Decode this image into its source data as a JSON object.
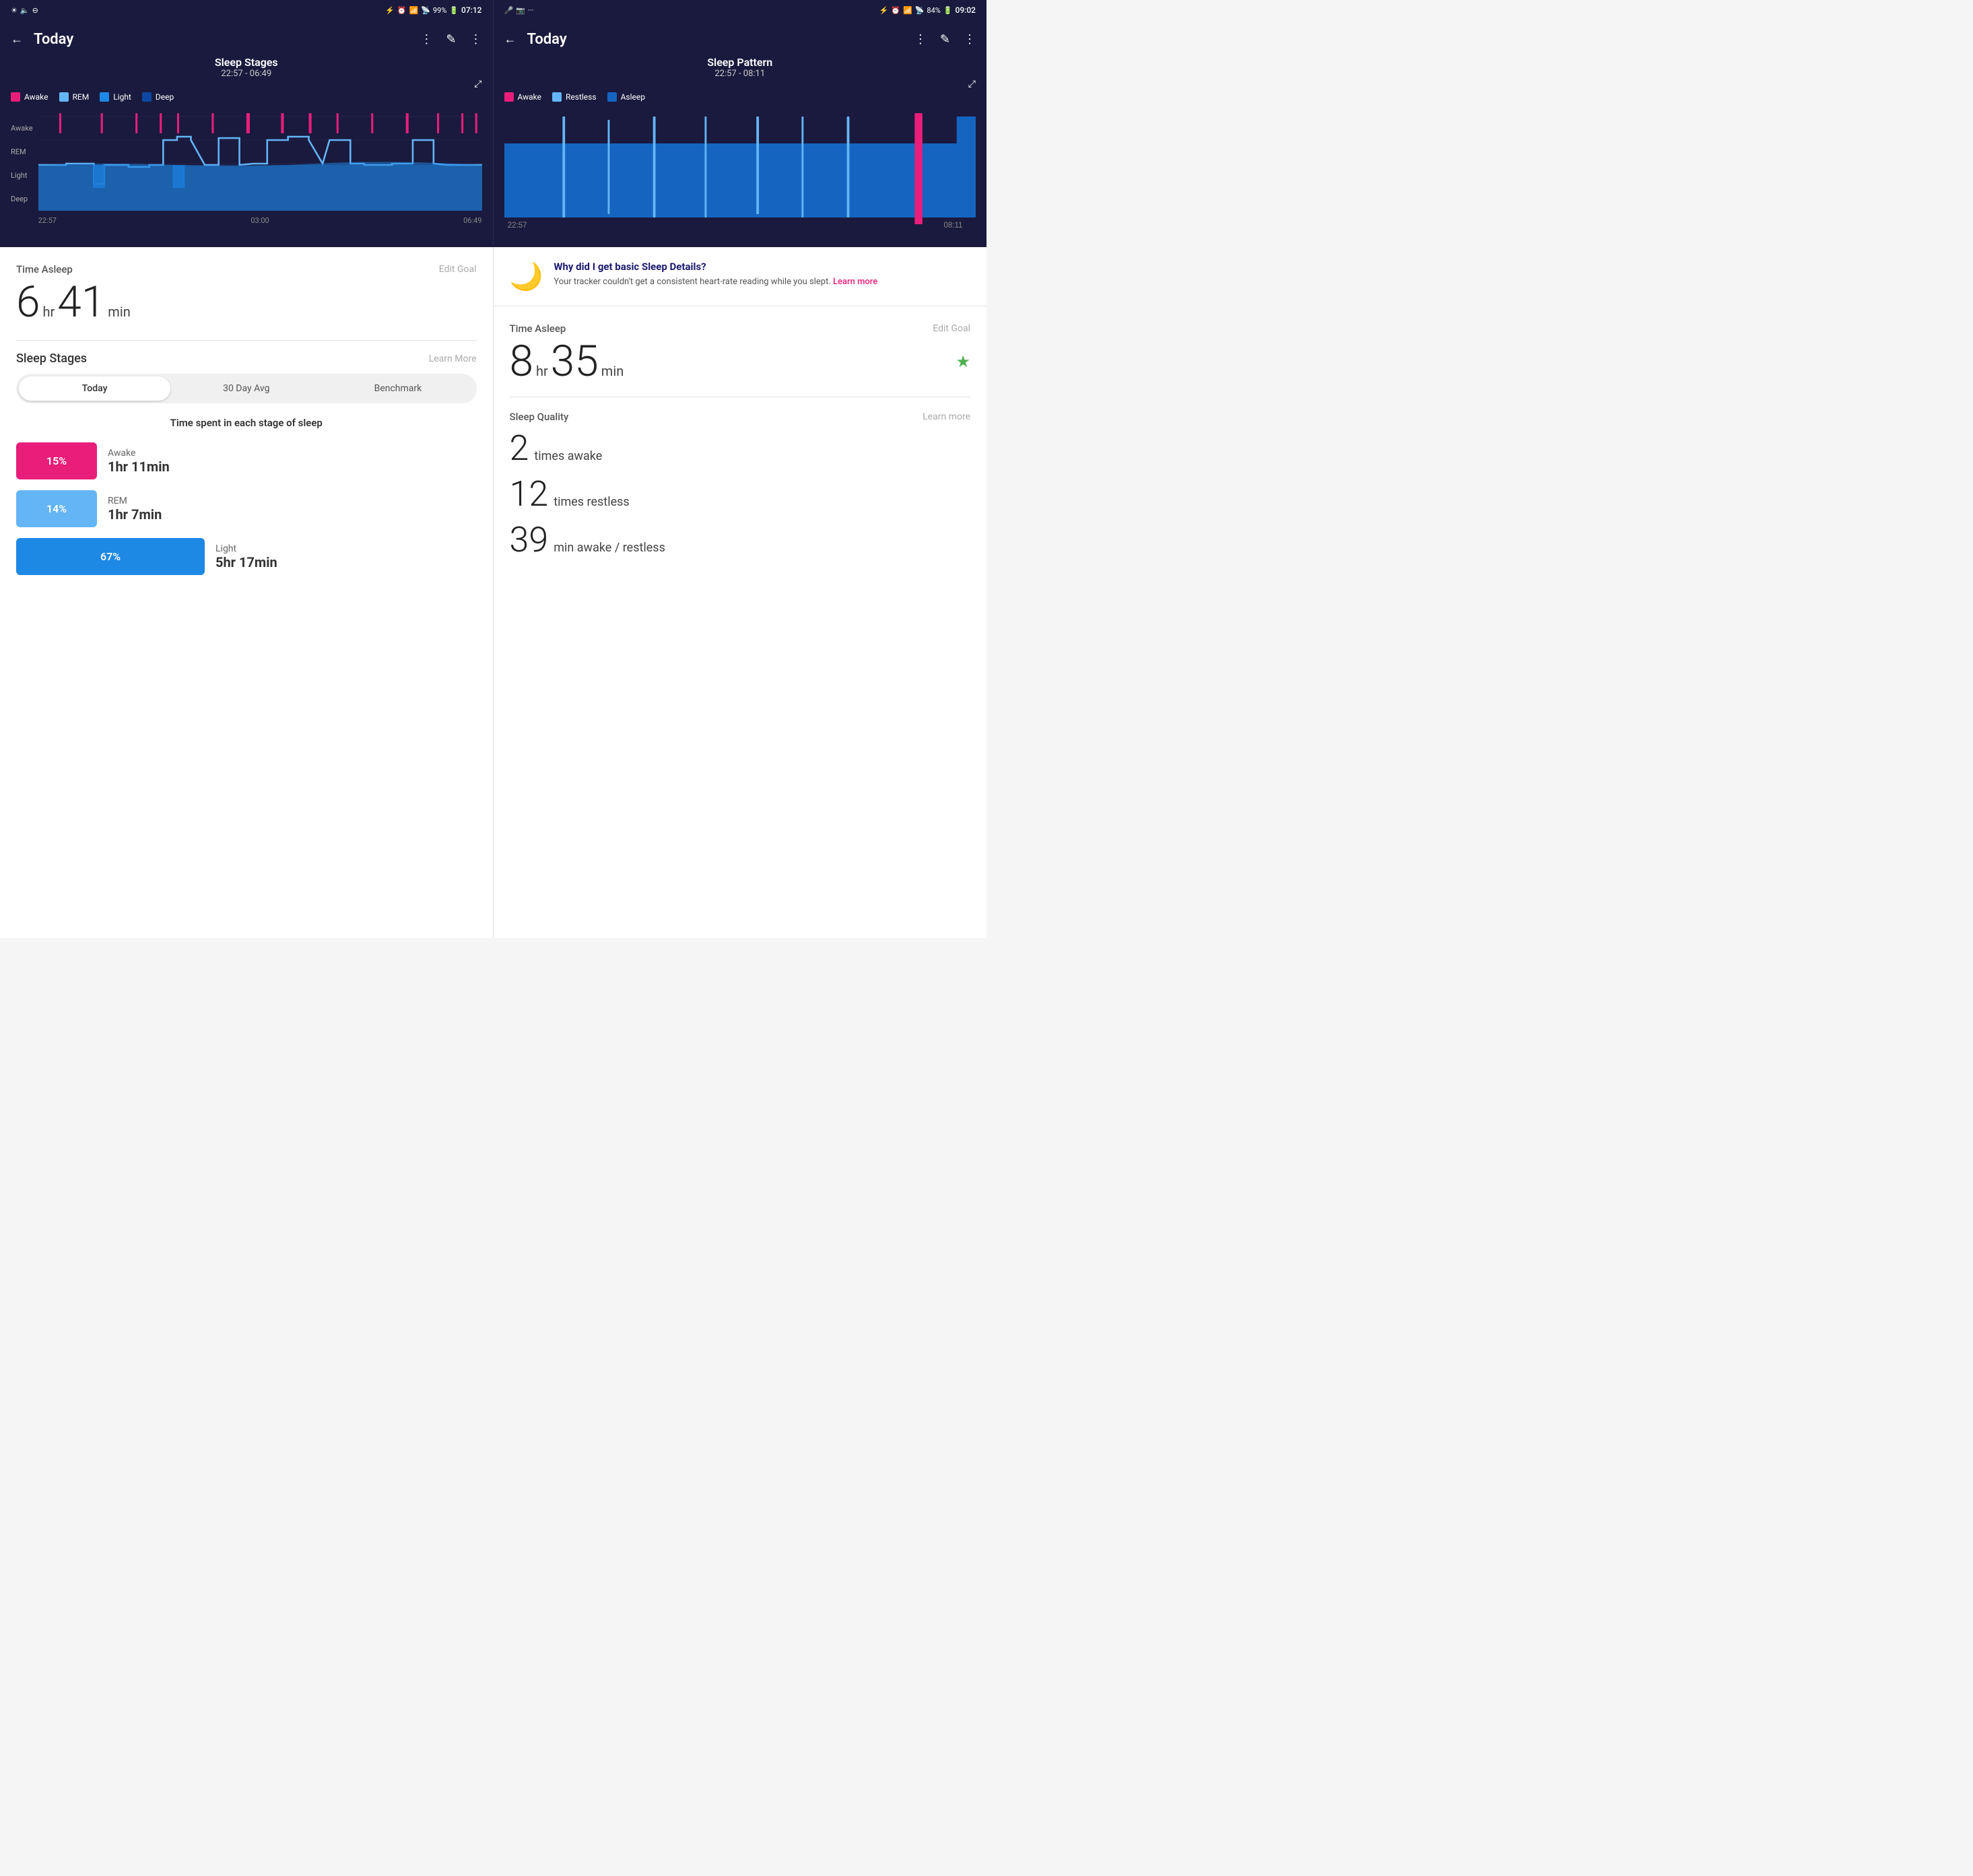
{
  "left_panel": {
    "status": {
      "time": "07:12",
      "battery": "99%"
    },
    "nav": {
      "back": "←",
      "title": "Today",
      "share": "⋮",
      "edit": "✎",
      "more": "⋮"
    },
    "chart": {
      "title": "Sleep Stages",
      "time_range": "22:57 - 06:49"
    },
    "legend": [
      {
        "label": "Awake",
        "color": "#e91e7a"
      },
      {
        "label": "REM",
        "color": "#64b5f6"
      },
      {
        "label": "Light",
        "color": "#1e88e5"
      },
      {
        "label": "Deep",
        "color": "#0d47a1"
      }
    ],
    "y_labels": [
      "Awake",
      "REM",
      "Light",
      "Deep"
    ],
    "x_labels": [
      "22:57",
      "03:00",
      "06:49"
    ],
    "time_asleep": {
      "label": "Time Asleep",
      "edit_goal": "Edit Goal",
      "hours": "6",
      "hr_unit": "hr",
      "minutes": "41",
      "min_unit": "min"
    },
    "sleep_stages": {
      "title": "Sleep Stages",
      "learn_more": "Learn More",
      "tabs": [
        "Today",
        "30 Day Avg",
        "Benchmark"
      ],
      "active_tab": 0,
      "subtitle": "Time spent in each stage of sleep",
      "stages": [
        {
          "name": "Awake",
          "percent": "15%",
          "duration": "1hr 11min",
          "color": "#e91e7a",
          "bar_width": 1
        },
        {
          "name": "REM",
          "percent": "14%",
          "duration": "1hr 7min",
          "color": "#64b5f6",
          "bar_width": 1
        },
        {
          "name": "Light",
          "percent": "67%",
          "duration": "5hr 17min",
          "color": "#1e88e5",
          "bar_width": 2.5
        }
      ]
    }
  },
  "right_panel": {
    "status": {
      "time": "09:02",
      "battery": "84%"
    },
    "nav": {
      "back": "←",
      "title": "Today"
    },
    "chart": {
      "title": "Sleep Pattern",
      "time_range": "22:57 - 08:11"
    },
    "legend": [
      {
        "label": "Awake",
        "color": "#e91e7a"
      },
      {
        "label": "Restless",
        "color": "#64b5f6"
      },
      {
        "label": "Asleep",
        "color": "#1565c0"
      }
    ],
    "x_labels": [
      "22:57",
      "08:11"
    ],
    "info_banner": {
      "title": "Why did I get basic Sleep Details?",
      "text": "Your tracker couldn't get a consistent heart-rate reading while you slept.",
      "learn_more": "Learn more"
    },
    "time_asleep": {
      "label": "Time Asleep",
      "edit_goal": "Edit Goal",
      "hours": "8",
      "hr_unit": "hr",
      "minutes": "35",
      "min_unit": "min",
      "star": "★"
    },
    "sleep_quality": {
      "title": "Sleep Quality",
      "learn_more": "Learn more",
      "stats": [
        {
          "number": "2",
          "desc": "times awake"
        },
        {
          "number": "12",
          "desc": "times restless"
        },
        {
          "number": "39",
          "desc": "min awake / restless"
        }
      ]
    }
  }
}
